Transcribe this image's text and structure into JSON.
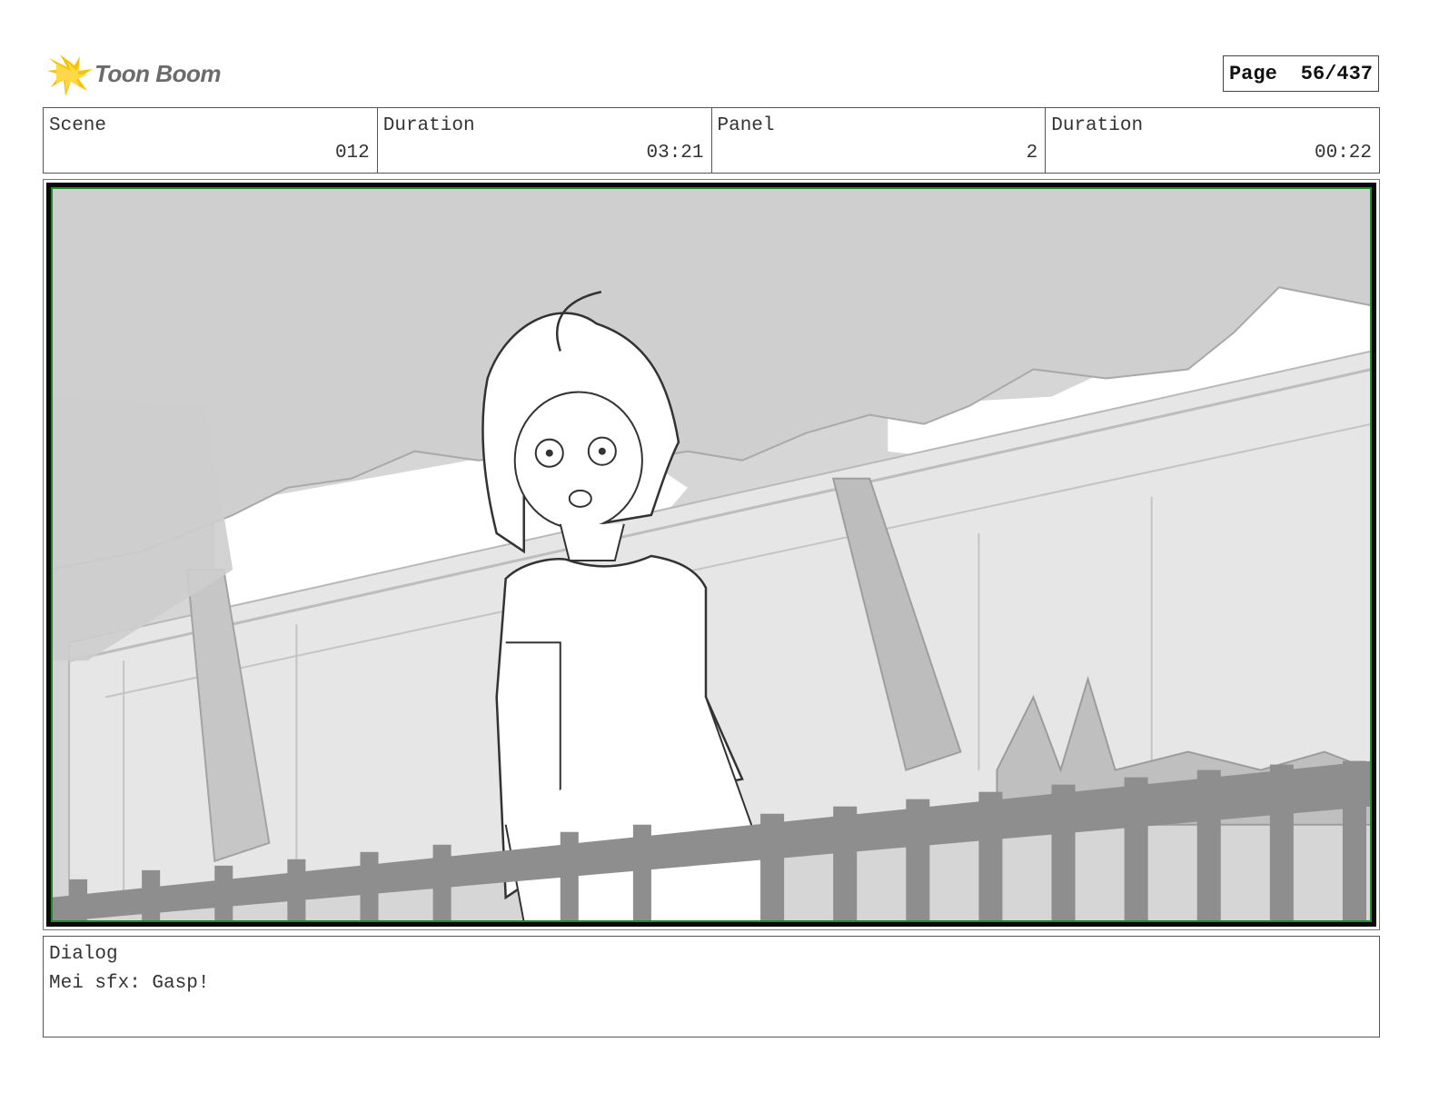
{
  "header": {
    "logo_text": "Toon Boom",
    "page_label": "Page",
    "page_value": "56/437"
  },
  "info": {
    "scene_label": "Scene",
    "scene_value": "012",
    "scene_duration_label": "Duration",
    "scene_duration_value": "03:21",
    "panel_label": "Panel",
    "panel_value": "2",
    "panel_duration_label": "Duration",
    "panel_duration_value": "00:22"
  },
  "dialog": {
    "label": "Dialog",
    "text": "Mei sfx: Gasp!"
  },
  "colors": {
    "logo_flash": "#f5c400",
    "frame_border": "#0a0a0a",
    "safe_area": "#1e8a2e"
  }
}
